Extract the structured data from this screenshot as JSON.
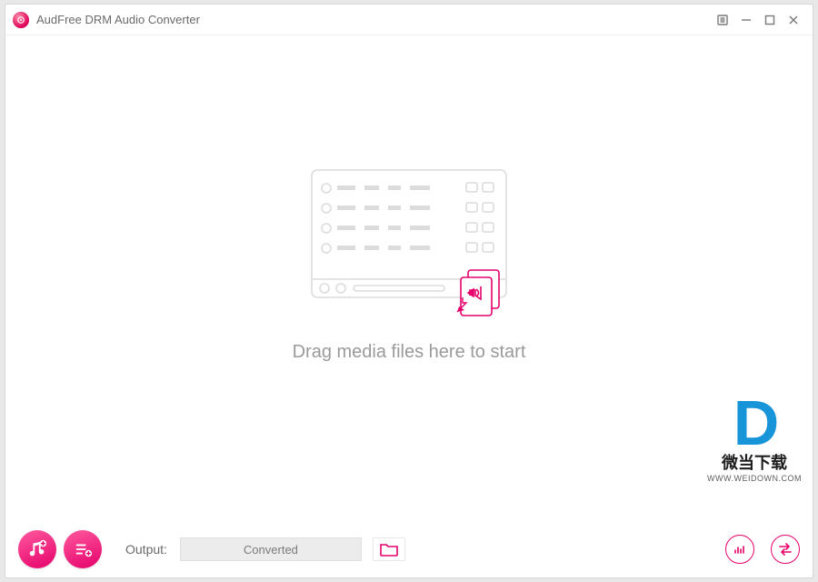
{
  "titlebar": {
    "app_name": "AudFree DRM Audio Converter"
  },
  "main": {
    "drop_hint": "Drag media files here to start"
  },
  "footer": {
    "output_label": "Output:",
    "output_value": "Converted"
  },
  "watermark": {
    "logo_letter": "D",
    "cn_text": "微当下载",
    "url_text": "WWW.WEIDOWN.COM"
  },
  "colors": {
    "accent": "#e5006b",
    "brand_blue": "#0c90d6"
  }
}
